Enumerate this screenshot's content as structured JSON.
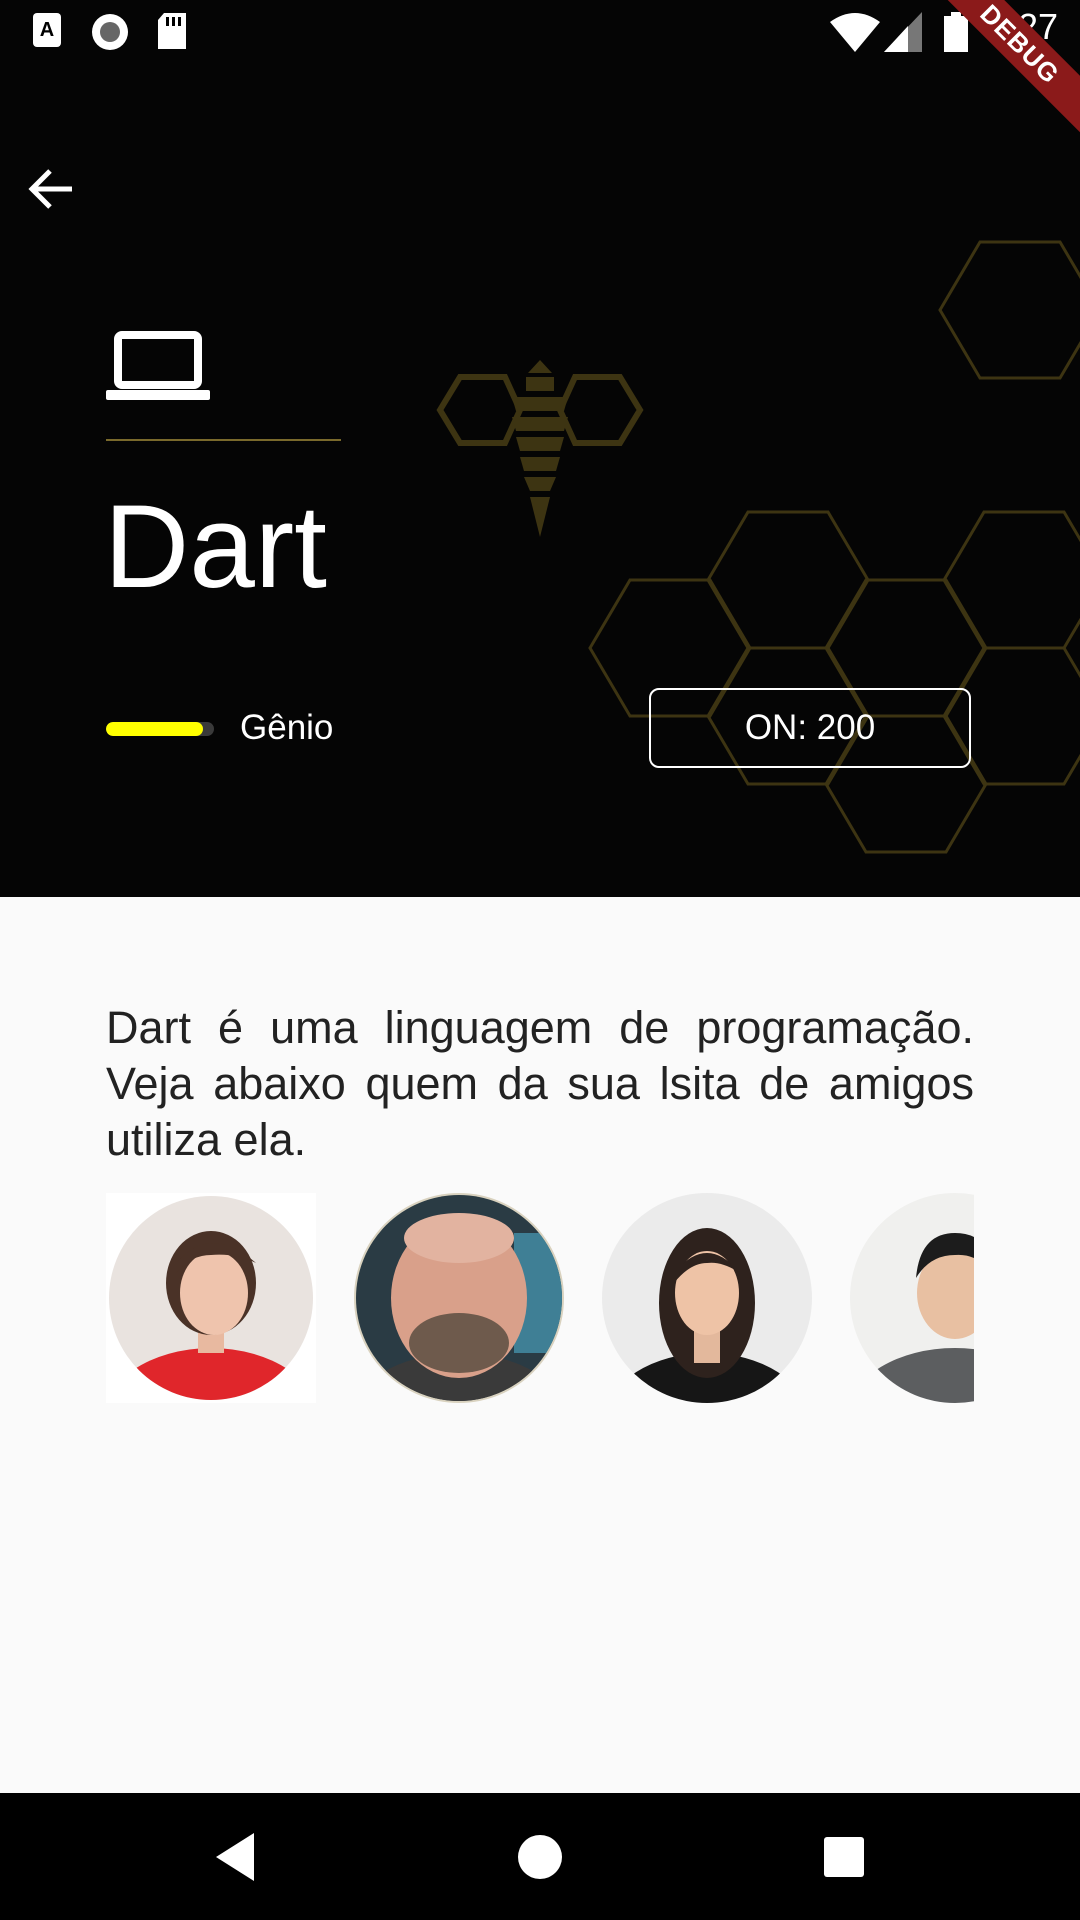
{
  "status_bar": {
    "time": "8:27",
    "icons": [
      "a-notification-icon",
      "record-icon",
      "sd-card-icon",
      "wifi-icon",
      "signal-icon",
      "battery-icon"
    ]
  },
  "debug_banner": {
    "label": "DEBUG"
  },
  "header": {
    "back_icon": "arrow-back-icon",
    "category_icon": "laptop-icon",
    "title": "Dart",
    "level": {
      "label": "Gênio",
      "value": 0.9
    },
    "online_button": "ON: 200"
  },
  "content": {
    "description": "Dart é uma linguagem de programação. Veja abaixo quem da sua lsita de amigos utiliza ela."
  },
  "friends": [
    {
      "avatar": "woman-red-shirt-avatar"
    },
    {
      "avatar": "bald-man-avatar"
    },
    {
      "avatar": "woman-dark-hair-avatar"
    },
    {
      "avatar": "man-gray-sweater-avatar"
    }
  ],
  "nav_bar": {
    "back": "back-triangle-icon",
    "home": "home-circle-icon",
    "recents": "recents-square-icon"
  },
  "colors": {
    "accent": "#ffff00",
    "gold": "#7a6a2c",
    "header_bg": "#050505",
    "page_bg": "#fafafa"
  }
}
